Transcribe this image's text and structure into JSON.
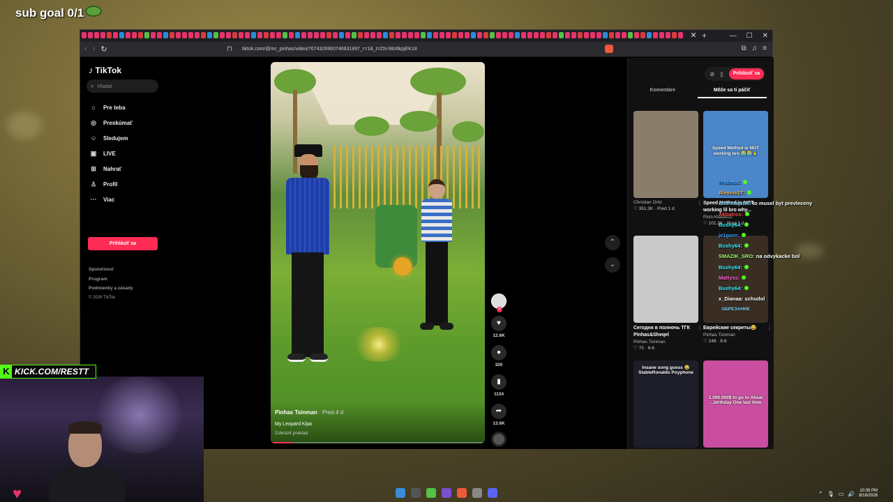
{
  "stream": {
    "sub_goal": "sub goal 0/1",
    "kick_url": "KICK.COM/RESTT",
    "chat": [
      {
        "user": "hraboss:",
        "message": "",
        "color": "#3aa0ff"
      },
      {
        "user": "Alexino17:",
        "message": "",
        "color": "#ffb347"
      },
      {
        "user": "chiefmajster:",
        "message": "to musel byt prevleceny",
        "color": "#7fd6ff"
      },
      {
        "user": "Akbatros:",
        "message": "",
        "color": "#ff4d4d"
      },
      {
        "user": "Bushy64:",
        "message": "",
        "color": "#3af0ff"
      },
      {
        "user": "je1gorn:",
        "message": "",
        "color": "#3aa0ff"
      },
      {
        "user": "Bushy64:",
        "message": "",
        "color": "#3af0ff"
      },
      {
        "user": "SMAZIK_SRO:",
        "message": "na odvykacke bol",
        "color": "#9dff6e"
      },
      {
        "user": "Bushy64:",
        "message": "",
        "color": "#3af0ff"
      },
      {
        "user": "Mattyss:",
        "message": "",
        "color": "#ff5fd0"
      },
      {
        "user": "Bushy64:",
        "message": "",
        "color": "#3af0ff"
      },
      {
        "user": "x_Dianaa:",
        "message": "schudol",
        "color": "#ffffff"
      }
    ]
  },
  "browser": {
    "url": "tiktok.com/@mc_pinhas/video/7674326960746631897_r=1&_t=ZN-98z6kpjEK18"
  },
  "tiktok": {
    "logo": "TikTok",
    "search_placeholder": "Hľadať",
    "nav": [
      {
        "label": "Pre teba",
        "icon": "home-icon",
        "glyph": "⌂"
      },
      {
        "label": "Preskúmať",
        "icon": "compass-icon",
        "glyph": "◎"
      },
      {
        "label": "Sledujem",
        "icon": "following-icon",
        "glyph": "👤"
      },
      {
        "label": "LIVE",
        "icon": "live-icon",
        "glyph": "▣"
      },
      {
        "label": "Nahrať",
        "icon": "upload-icon",
        "glyph": "⊞"
      },
      {
        "label": "Profil",
        "icon": "profile-icon",
        "glyph": "♙"
      },
      {
        "label": "Viac",
        "icon": "more-icon",
        "glyph": "···"
      }
    ],
    "login_label": "Prihlásiť sa",
    "footer": [
      "Spoločnosť",
      "Program",
      "Podmienky a zásady"
    ],
    "copyright": "© 2026 TikTok",
    "video": {
      "author": "Pinhas Tsinman",
      "time": " · Pred 4 d",
      "caption": "My Leopard Kipa",
      "translate": "Zobraziť preklad",
      "progress": 0.1
    },
    "actions": {
      "likes": "12.6K",
      "comments": "320",
      "saves": "1134",
      "shares": "13.6K"
    },
    "right_panel": {
      "login_label": "Prihlásiť sa",
      "tabs": [
        "Komentáre",
        "Môže sa ti páčiť"
      ],
      "cards": [
        {
          "title": "",
          "author": "Christian Ortiz",
          "meta": "♡ 351.3K · Pred 1 d",
          "thumb_text": "",
          "bg": "#8a7d6c"
        },
        {
          "title": "Speed Method is NOT working lil bro why...",
          "author": "Pisin Klawless",
          "meta": "♡ 101.3K · Pred 1 d",
          "thumb_text": "Speed Method is NOT working bro 😭😭🙏",
          "bg": "#4a86c8"
        },
        {
          "title": "Сегодня в полночь ТГК Pinhas&Sheqel",
          "author": "Pinhas Tsinman",
          "meta": "♡ 75 · 8-6",
          "thumb_text": "",
          "bg": "#c9c9c9"
        },
        {
          "title": "Еврейские секреты😂",
          "author": "Pinhas Tsinman",
          "meta": "♡ 248 · 8-8",
          "thumb_text": "ОБРЕЗАНИЕ",
          "bg": "#3a2e24"
        },
        {
          "title": "",
          "author": "",
          "meta": "",
          "thumb_text": "Insane song guess 😂 StableRonaldo Poyphone",
          "bg": "#1e1e2a"
        },
        {
          "title": "",
          "author": "",
          "meta": "",
          "thumb_text": "1.000.000$ to go to Absal ...birthday One last time",
          "bg": "#c94ea0"
        }
      ]
    }
  },
  "taskbar": {
    "time": "10:39 PM",
    "date": "8/18/2026"
  }
}
